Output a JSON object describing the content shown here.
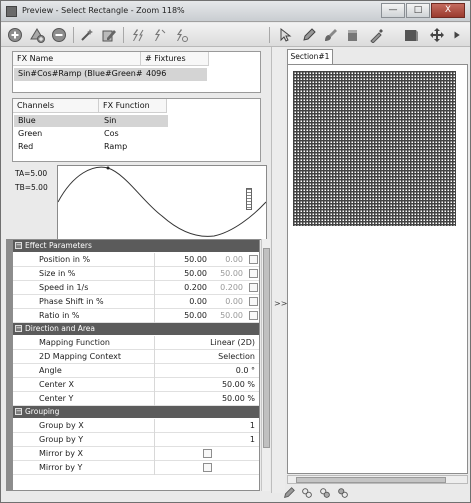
{
  "window": {
    "title": "Preview - Select Rectangle - Zoom 118%",
    "minimize": "—",
    "maximize": "□",
    "close": "X"
  },
  "toolbar_left": [
    "add-icon",
    "add-effect-icon",
    "remove-icon",
    "wand-icon",
    "edit-icon",
    "lightning-icon",
    "lightning-icon",
    "lightning-icon"
  ],
  "toolbar_right": [
    "pointer-icon",
    "pencil-icon",
    "brush-icon",
    "bucket-icon",
    "eyedropper-icon",
    "shape-icon",
    "move-icon",
    "more-icon"
  ],
  "fx_table": {
    "headers": [
      "FX Name",
      "# Fixtures"
    ],
    "rows": [
      {
        "name": "Sin#Cos#Ramp (Blue#Green#...",
        "fixtures": "4096"
      }
    ]
  },
  "channels_table": {
    "headers": [
      "Channels",
      "FX Function"
    ],
    "rows": [
      {
        "channel": "Blue",
        "function": "Sin"
      },
      {
        "channel": "Green",
        "function": "Cos"
      },
      {
        "channel": "Red",
        "function": "Ramp"
      }
    ]
  },
  "waveform": {
    "ta": "TA=5.00",
    "tb": "TB=5.00"
  },
  "property_grid": {
    "sections": [
      {
        "title": "Effect Parameters",
        "rows": [
          {
            "name": "Position in %",
            "value": "50.00",
            "default": "0.00",
            "check": true
          },
          {
            "name": "Size in %",
            "value": "50.00",
            "default": "50.00",
            "check": true
          },
          {
            "name": "Speed in 1/s",
            "value": "0.200",
            "default": "0.200",
            "check": true
          },
          {
            "name": "Phase Shift in %",
            "value": "0.00",
            "default": "0.00",
            "check": true
          },
          {
            "name": "Ratio in %",
            "value": "50.00",
            "default": "50.00",
            "check": true
          }
        ]
      },
      {
        "title": "Direction and Area",
        "rows": [
          {
            "name": "Mapping Function",
            "value": "Linear (2D)"
          },
          {
            "name": "2D Mapping Context",
            "value": "Selection"
          },
          {
            "name": "Angle",
            "value": "0.0 °"
          },
          {
            "name": "Center X",
            "value": "50.00 %"
          },
          {
            "name": "Center Y",
            "value": "50.00 %"
          }
        ]
      },
      {
        "title": "Grouping",
        "rows": [
          {
            "name": "Group by X",
            "value": "1"
          },
          {
            "name": "Group by Y",
            "value": "1"
          },
          {
            "name": "Mirror by X",
            "value": "",
            "checkbox": true
          },
          {
            "name": "Mirror by Y",
            "value": "",
            "checkbox": true
          }
        ]
      }
    ]
  },
  "splitter_arrow": ">>",
  "preview": {
    "tab": "Section#1"
  },
  "colors": {
    "section_header": "#5b5b5b",
    "selected_row": "#d4d4d4"
  }
}
